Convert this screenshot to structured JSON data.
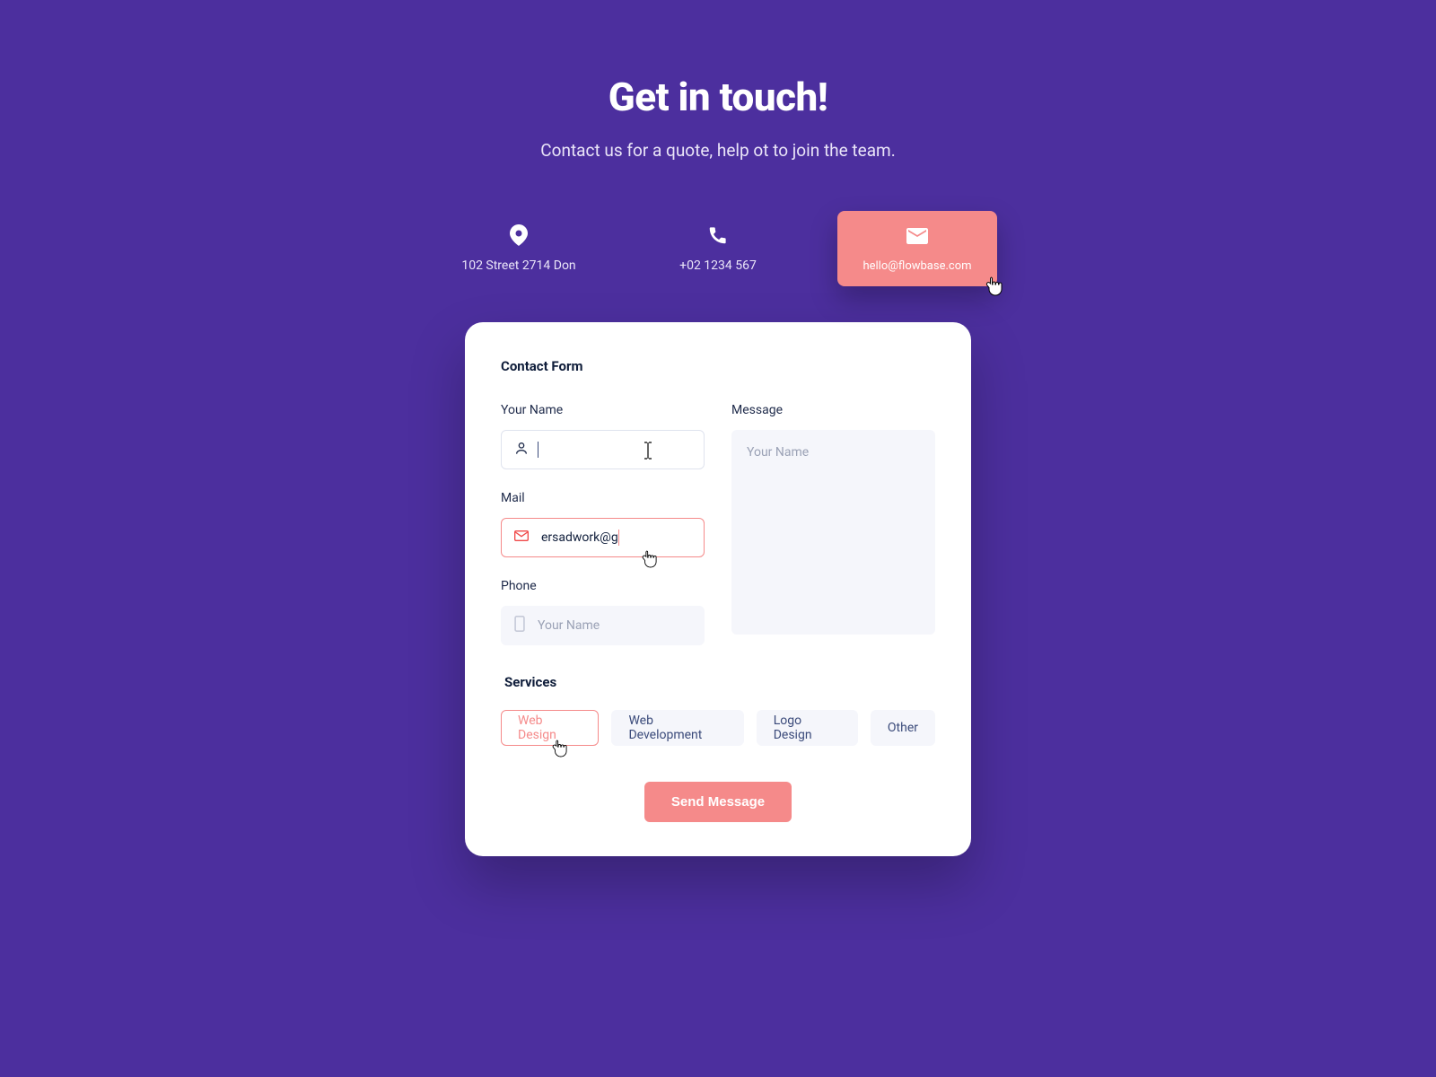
{
  "hero": {
    "title": "Get in touch!",
    "subtitle": "Contact us for a quote, help ot to join the team."
  },
  "contacts": {
    "address": "102 Street 2714 Don",
    "phone": "+02 1234 567",
    "email": "hello@flowbase.com"
  },
  "card": {
    "title": "Contact Form",
    "name_label": "Your Name",
    "name_value": "",
    "mail_label": "Mail",
    "mail_value": "ersadwork@g",
    "phone_label": "Phone",
    "phone_placeholder": "Your Name",
    "message_label": "Message",
    "message_placeholder": "Your Name",
    "services_label": "Services",
    "chips": [
      "Web Design",
      "Web Development",
      "Logo Design",
      "Other"
    ],
    "submit": "Send Message"
  },
  "colors": {
    "bg": "#4c2f9e",
    "accent": "#f58a8a"
  }
}
